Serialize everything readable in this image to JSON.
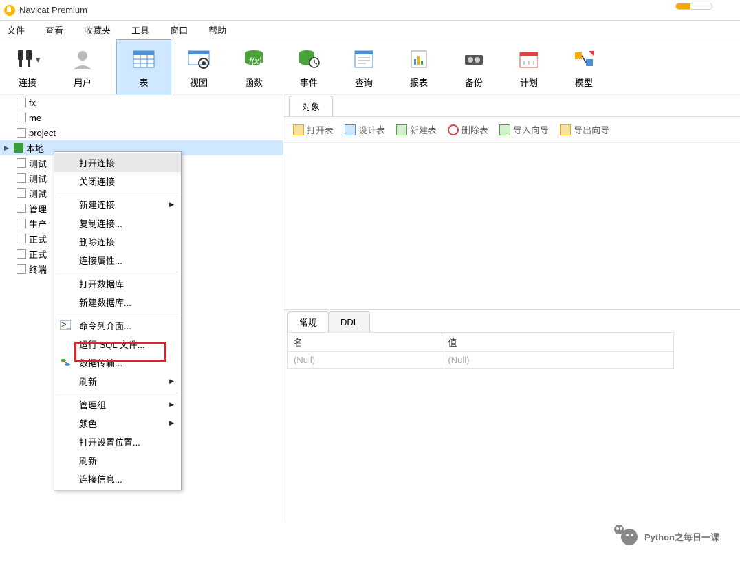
{
  "app": {
    "title": "Navicat Premium"
  },
  "menu": [
    "文件",
    "查看",
    "收藏夹",
    "工具",
    "窗口",
    "帮助"
  ],
  "toolbar": [
    {
      "id": "connect",
      "label": "连接"
    },
    {
      "id": "user",
      "label": "用户"
    },
    {
      "id": "table",
      "label": "表",
      "active": true
    },
    {
      "id": "view",
      "label": "视图"
    },
    {
      "id": "func",
      "label": "函数"
    },
    {
      "id": "event",
      "label": "事件"
    },
    {
      "id": "query",
      "label": "查询"
    },
    {
      "id": "report",
      "label": "报表"
    },
    {
      "id": "backup",
      "label": "备份"
    },
    {
      "id": "plan",
      "label": "计划"
    },
    {
      "id": "model",
      "label": "模型"
    }
  ],
  "tree": [
    {
      "label": "fx"
    },
    {
      "label": "me"
    },
    {
      "label": "project"
    },
    {
      "label": "本地",
      "selected": true,
      "expanded": true,
      "green": true
    },
    {
      "label": "测试"
    },
    {
      "label": "测试"
    },
    {
      "label": "测试"
    },
    {
      "label": "管理"
    },
    {
      "label": "生产"
    },
    {
      "label": "正式"
    },
    {
      "label": "正式"
    },
    {
      "label": "终端"
    }
  ],
  "context_menu": [
    {
      "label": "打开连接",
      "hover": true
    },
    {
      "label": "关闭连接"
    },
    {
      "sep": true
    },
    {
      "label": "新建连接",
      "arrow": true
    },
    {
      "label": "复制连接..."
    },
    {
      "label": "删除连接"
    },
    {
      "label": "连接属性..."
    },
    {
      "sep": true
    },
    {
      "label": "打开数据库"
    },
    {
      "label": "新建数据库..."
    },
    {
      "sep": true
    },
    {
      "label": "命令列介面...",
      "icon": "cmd"
    },
    {
      "label": "运行 SQL 文件...",
      "highlight": true
    },
    {
      "label": "数据传输...",
      "icon": "transfer"
    },
    {
      "label": "刷新",
      "arrow": true
    },
    {
      "sep": true
    },
    {
      "label": "管理组",
      "arrow": true
    },
    {
      "label": "颜色",
      "arrow": true
    },
    {
      "label": "打开设置位置..."
    },
    {
      "label": "刷新"
    },
    {
      "label": "连接信息..."
    }
  ],
  "right": {
    "object_tab": "对象",
    "obj_tools": [
      {
        "id": "open",
        "label": "打开表",
        "color": "#f0b000"
      },
      {
        "id": "design",
        "label": "设计表",
        "color": "#4a90d9"
      },
      {
        "id": "new",
        "label": "新建表",
        "color": "#4aa33a"
      },
      {
        "id": "delete",
        "label": "删除表",
        "color": "#d44"
      },
      {
        "id": "import",
        "label": "导入向导",
        "color": "#4aa33a"
      },
      {
        "id": "export",
        "label": "导出向导",
        "color": "#f0b000"
      }
    ],
    "lower_tabs": [
      "常规",
      "DDL"
    ],
    "prop_headers": [
      "名",
      "值"
    ],
    "prop_row": [
      "(Null)",
      "(Null)"
    ]
  },
  "watermark": "Python之每日一课"
}
